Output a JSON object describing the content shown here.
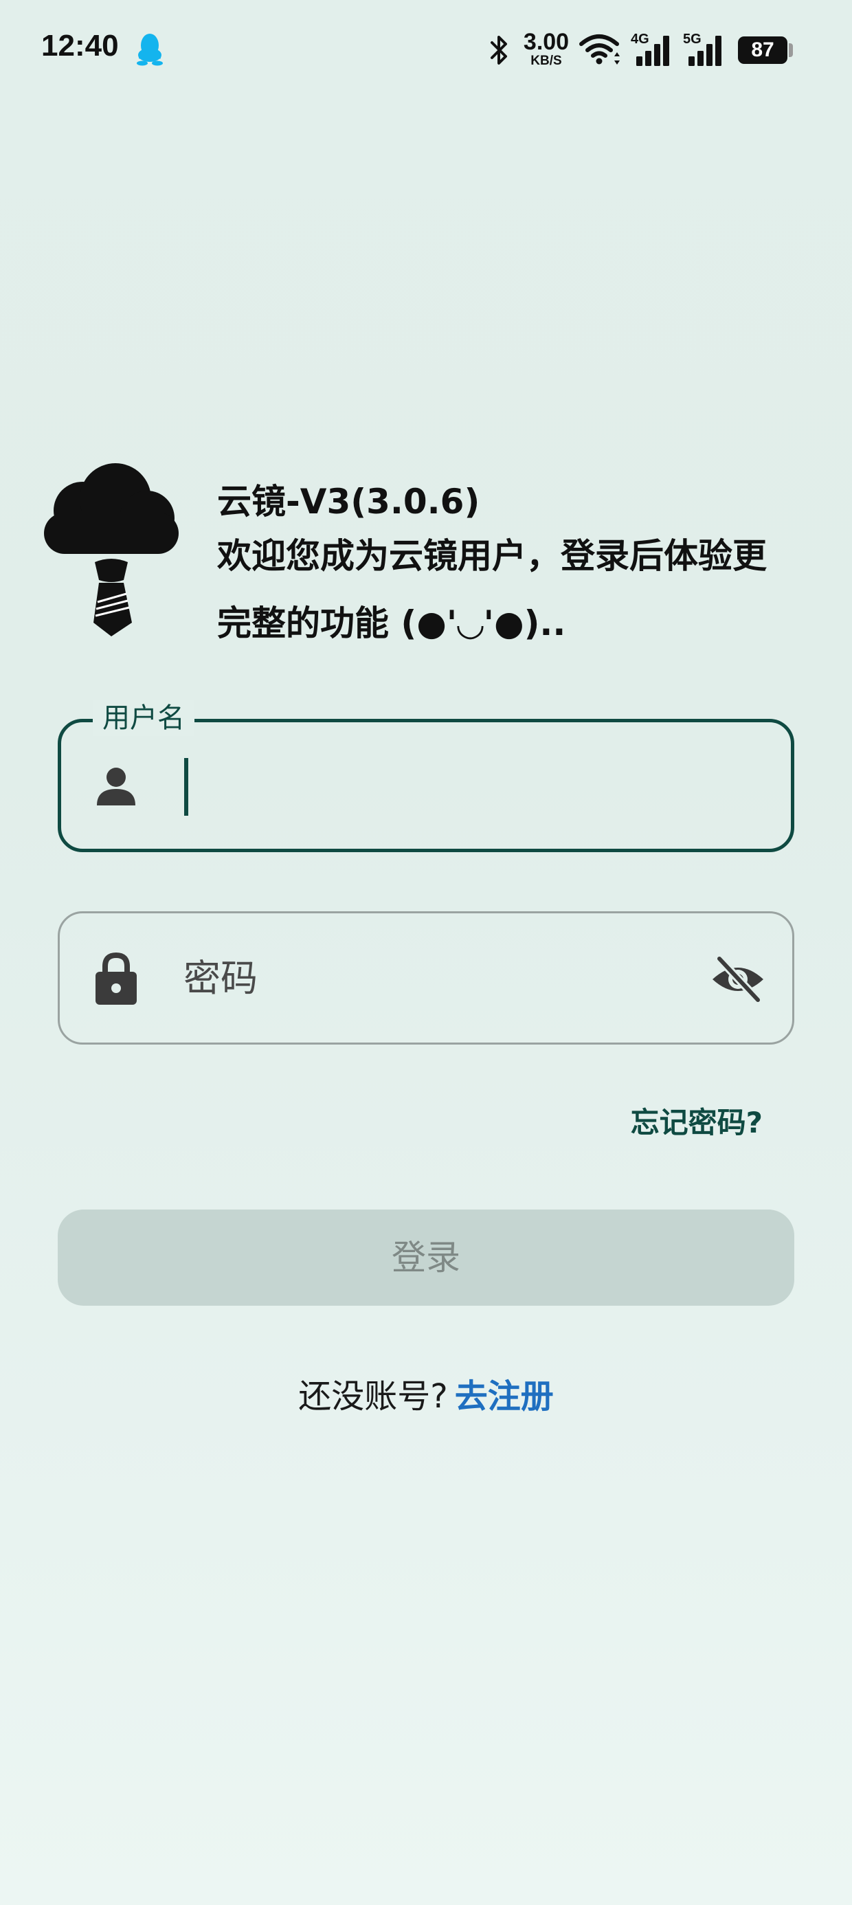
{
  "status_bar": {
    "time": "12:40",
    "net_speed_value": "3.00",
    "net_speed_unit": "KB/S",
    "signal_1_label": "4G",
    "signal_2_label": "5G",
    "battery": "87",
    "notification_icon": "qq-penguin-icon",
    "colors": {
      "qq_icon": "#14b4ee"
    }
  },
  "header": {
    "title": "云镜-V3(3.0.6)",
    "welcome_line_1": "欢迎您成为云镜用户，登录后体验更",
    "welcome_line_2": "完整的功能 (●'◡'●)..",
    "logo_icon": "cloud-head-with-tie-logo"
  },
  "form": {
    "username": {
      "label": "用户名",
      "value": "",
      "icon": "person-icon"
    },
    "password": {
      "placeholder": "密码",
      "value": "",
      "icon": "lock-icon",
      "visibility_icon": "eye-off-icon"
    },
    "forgot_password": "忘记密码?",
    "login_button": "登录",
    "no_account_text": "还没账号?",
    "register_link": "去注册"
  },
  "colors": {
    "accent": "#0f4a42",
    "link_blue": "#1f6fc0",
    "button_disabled_bg": "#c5d5d1",
    "button_disabled_text": "#7f8986",
    "background": "#e2efeb"
  }
}
